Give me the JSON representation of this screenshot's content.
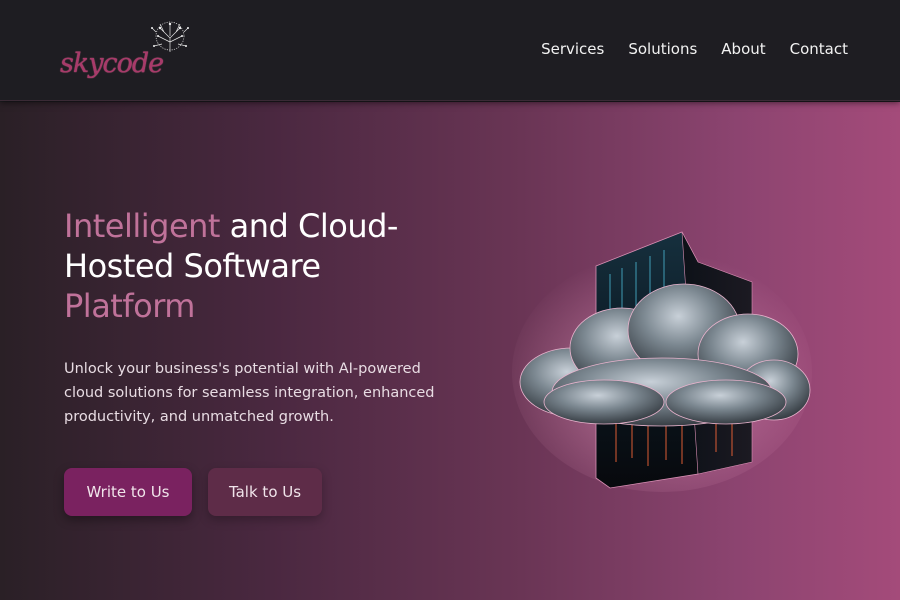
{
  "brand": {
    "name": "skycode"
  },
  "nav": {
    "items": [
      {
        "label": "Services"
      },
      {
        "label": "Solutions"
      },
      {
        "label": "About"
      },
      {
        "label": "Contact"
      }
    ]
  },
  "hero": {
    "headline": {
      "part1": "Intelligent",
      "part2": " and Cloud-Hosted Software ",
      "part3": "Platform"
    },
    "subtext": "Unlock your business's potential with AI-powered cloud solutions for seamless integration, enhanced productivity, and unmatched growth.",
    "primary_cta": "Write to Us",
    "secondary_cta": "Talk to Us",
    "image_icon": "cloud-server-illustration"
  },
  "colors": {
    "accent": "#c0729a",
    "primary_button": "#7a2260",
    "navbar": "#1e1d22",
    "logo": "#a83a6a"
  }
}
